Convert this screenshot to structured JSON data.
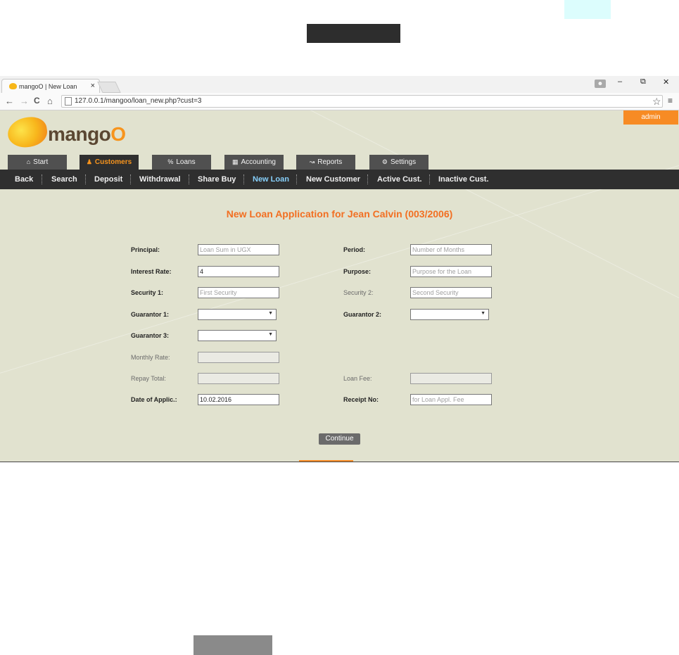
{
  "browser": {
    "tab_title": "mangoO | New Loan",
    "tab_close": "×",
    "url": "127.0.0.1/mangoo/loan_new.php?cust=3",
    "window": {
      "minimize": "–",
      "restore": "⧉",
      "close": "✕"
    },
    "nav": {
      "back": "←",
      "forward": "→",
      "reload": "C",
      "home": "⌂"
    },
    "star": "☆",
    "menu": "≡"
  },
  "app": {
    "user": "admin",
    "logo": "mangoO",
    "main_tabs": [
      {
        "label": "Start",
        "icon": "home-icon"
      },
      {
        "label": "Customers",
        "icon": "user-icon",
        "active": true
      },
      {
        "label": "Loans",
        "icon": "percent-icon"
      },
      {
        "label": "Accounting",
        "icon": "calculator-icon"
      },
      {
        "label": "Reports",
        "icon": "chart-icon"
      },
      {
        "label": "Settings",
        "icon": "gear-icon"
      }
    ],
    "sub_nav": [
      "Back",
      "Search",
      "Deposit",
      "Withdrawal",
      "Share Buy",
      "New Loan",
      "New Customer",
      "Active Cust.",
      "Inactive Cust."
    ],
    "sub_nav_active": "New Loan"
  },
  "form": {
    "title": "New Loan Application for Jean Calvin (003/2006)",
    "principal_label": "Principal:",
    "principal_placeholder": "Loan Sum in UGX",
    "period_label": "Period:",
    "period_placeholder": "Number of Months",
    "interest_label": "Interest Rate:",
    "interest_value": "4",
    "purpose_label": "Purpose:",
    "purpose_placeholder": "Purpose for the Loan",
    "security1_label": "Security 1:",
    "security1_placeholder": "First Security",
    "security2_label": "Security 2:",
    "security2_placeholder": "Second Security",
    "guarantor1_label": "Guarantor 1:",
    "guarantor2_label": "Guarantor 2:",
    "guarantor3_label": "Guarantor 3:",
    "monthly_rate_label": "Monthly Rate:",
    "repay_total_label": "Repay Total:",
    "loan_fee_label": "Loan Fee:",
    "date_label": "Date of Applic.:",
    "date_value": "10.02.2016",
    "receipt_label": "Receipt No:",
    "receipt_placeholder": "for Loan Appl. Fee",
    "continue_label": "Continue"
  },
  "colors": {
    "accent": "#f78b24",
    "heading": "#f26f22",
    "background": "#e1e2cf",
    "nav_dark": "#2f2f2f",
    "active_link": "#86cffa"
  }
}
